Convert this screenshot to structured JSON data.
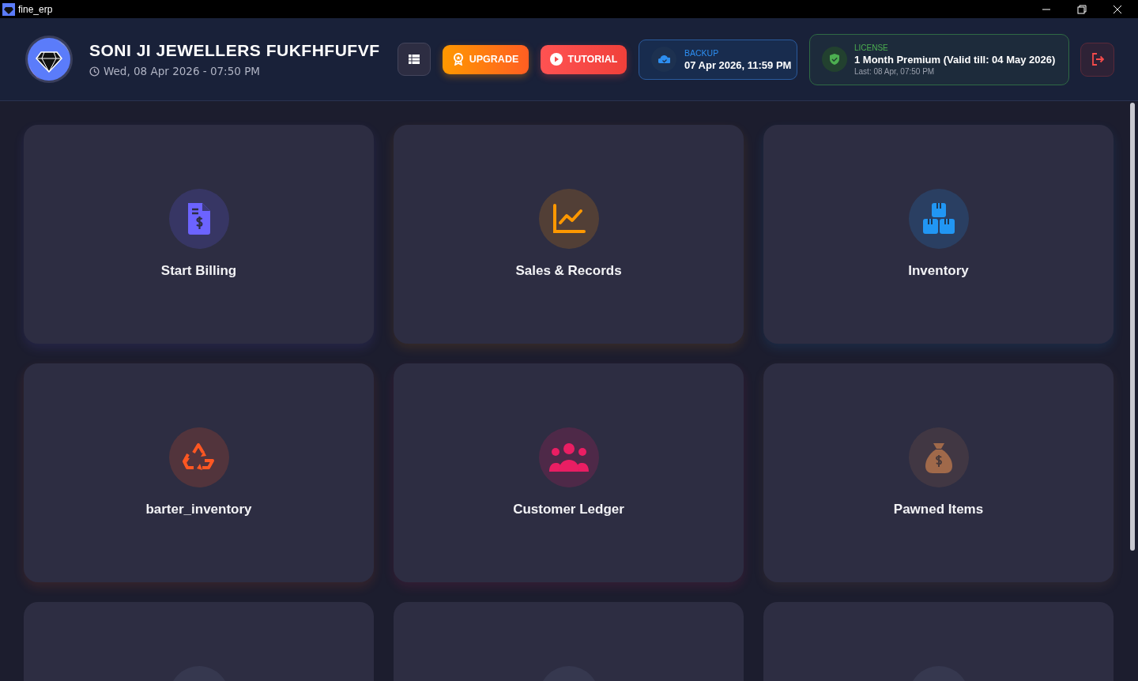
{
  "window": {
    "title": "fine_erp"
  },
  "header": {
    "business_name": "SONI JI JEWELLERS FUKFHFUFVF",
    "datetime": "Wed, 08 Apr 2026 - 07:50 PM",
    "upgrade_button": "UPGRADE",
    "tutorial_button": "TUTORIAL",
    "backup": {
      "label": "BACKUP",
      "value": "07 Apr 2026, 11:59 PM"
    },
    "license": {
      "label": "LICENSE",
      "plan": "1 Month Premium (Valid till: 04 May 2026)",
      "last": "Last: 08 Apr, 07:50 PM"
    }
  },
  "tiles": [
    {
      "label": "Start Billing",
      "kind": "billing",
      "color": "#6c63ff"
    },
    {
      "label": "Sales & Records",
      "kind": "chart",
      "color": "#ff9800"
    },
    {
      "label": "Inventory",
      "kind": "boxes",
      "color": "#2196f3"
    },
    {
      "label": "barter_inventory",
      "kind": "recycle",
      "color": "#ff5722"
    },
    {
      "label": "Customer Ledger",
      "kind": "users",
      "color": "#e91e63"
    },
    {
      "label": "Pawned Items",
      "kind": "moneybag",
      "color": "#a0694a"
    },
    {
      "kind": "blank"
    },
    {
      "kind": "blank"
    },
    {
      "kind": "blank"
    }
  ]
}
